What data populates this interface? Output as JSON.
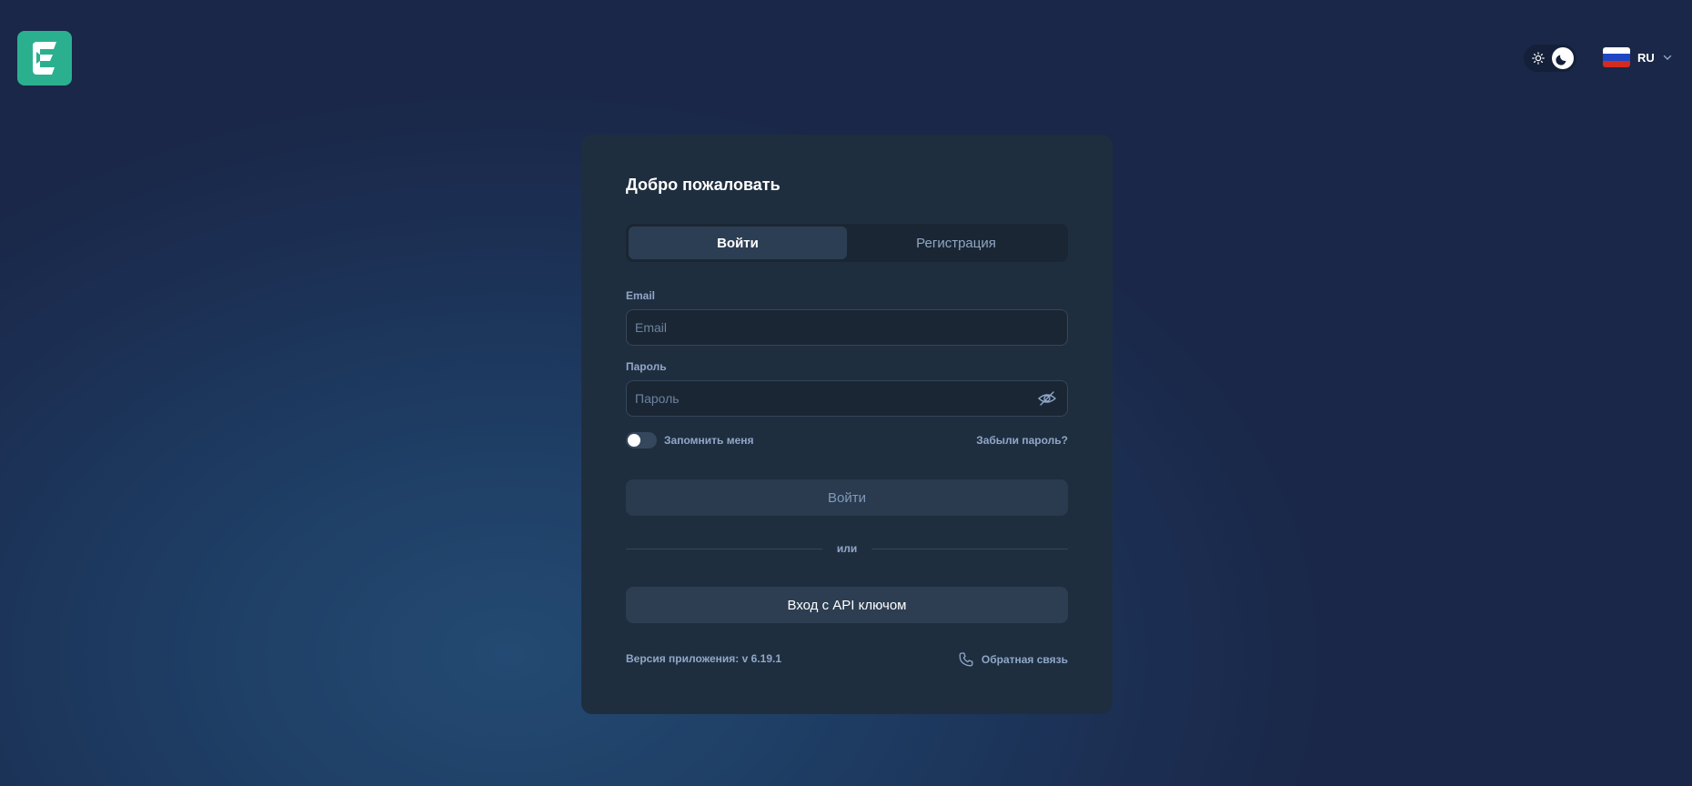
{
  "header": {
    "logo_icon": "app-logo-icon",
    "theme_toggle": {
      "light_icon": "sun-icon",
      "dark_icon": "moon-icon",
      "selected": "dark"
    },
    "language": {
      "code": "RU",
      "flag": "russia-flag-icon",
      "chevron": "chevron-down-icon"
    }
  },
  "card": {
    "title": "Добро пожаловать",
    "tabs": [
      {
        "label": "Войти",
        "active": true
      },
      {
        "label": "Регистрация",
        "active": false
      }
    ],
    "email": {
      "label": "Email",
      "placeholder": "Email",
      "value": ""
    },
    "password": {
      "label": "Пароль",
      "placeholder": "Пароль",
      "value": "",
      "toggle_icon": "eye-off-icon"
    },
    "remember_me": {
      "label": "Запомнить меня",
      "checked": false
    },
    "forgot_password": "Забыли пароль?",
    "login_button": "Войти",
    "divider_text": "или",
    "api_key_button": "Вход с API ключом",
    "version": "Версия приложения: v 6.19.1",
    "feedback": {
      "label": "Обратная связь",
      "icon": "phone-icon"
    }
  },
  "colors": {
    "background": "#1c3358",
    "card": "#1f2e3f",
    "accent": "#2bb08f",
    "muted_text": "#8fa8c8"
  }
}
